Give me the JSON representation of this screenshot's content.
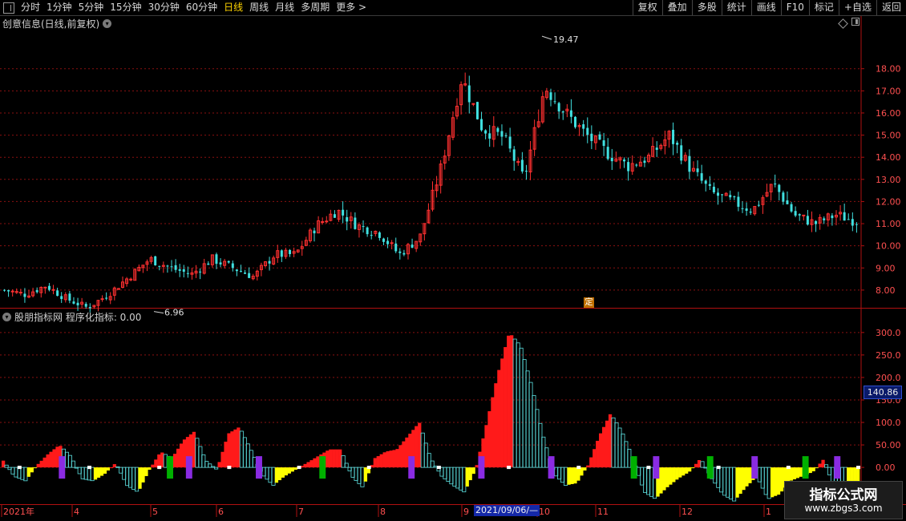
{
  "toolbar": {
    "periods": [
      "分时",
      "1分钟",
      "5分钟",
      "15分钟",
      "30分钟",
      "60分钟",
      "日线",
      "周线",
      "月线",
      "多周期",
      "更多 >"
    ],
    "active_period": "日线",
    "right_buttons": [
      "复权",
      "叠加",
      "多股",
      "统计",
      "画线",
      "F10",
      "标记",
      "+自选",
      "返回"
    ]
  },
  "main_panel": {
    "title": "创意信息(日线,前复权)",
    "price_axis": [
      "18.00",
      "17.00",
      "16.00",
      "15.00",
      "14.00",
      "13.00",
      "12.00",
      "11.00",
      "10.00",
      "9.00",
      "8.00"
    ],
    "high_label": "19.47",
    "low_label": "6.96",
    "marker_label": "定"
  },
  "indicator_panel": {
    "title": "股朋指标网 程序化指标: 0.00",
    "value_axis": [
      "300.0",
      "250.0",
      "200.0",
      "150.0",
      "100.0",
      "50.00",
      "0.00"
    ],
    "current_value": "140.86"
  },
  "date_axis": {
    "labels": [
      "2021年",
      "4",
      "5",
      "6",
      "7",
      "8",
      "9",
      "10",
      "11",
      "12",
      "1"
    ],
    "highlight": "2021/09/06/—"
  },
  "watermark": {
    "title": "指标公式网",
    "url": "www.zbgs3.com"
  },
  "colors": {
    "up": "#ff3030",
    "down": "#40e0e0",
    "grid": "#8a1010",
    "axis_text": "#ff5050",
    "active": "#ffd400"
  },
  "chart_data": [
    {
      "type": "candlestick",
      "ylim": [
        7.2,
        19.8
      ],
      "close_trend": [
        8.0,
        7.8,
        8.2,
        7.6,
        7.2,
        7.8,
        8.6,
        9.4,
        9.0,
        8.7,
        9.4,
        9.0,
        8.6,
        9.6,
        9.6,
        10.9,
        11.6,
        10.9,
        10.6,
        9.6,
        10.4,
        13.5,
        17.6,
        15.3,
        14.9,
        13.0,
        17.2,
        16.0,
        15.0,
        14.2,
        13.6,
        14.0,
        15.0,
        13.5,
        12.4,
        12.0,
        11.6,
        12.8,
        11.4,
        11.0,
        11.4,
        11.1
      ]
    },
    {
      "type": "histogram",
      "ylim": [
        -80,
        330
      ],
      "values": [
        15,
        -20,
        -30,
        5,
        30,
        50,
        25,
        -25,
        -30,
        -15,
        10,
        -40,
        -55,
        -5,
        35,
        20,
        60,
        80,
        15,
        -5,
        75,
        90,
        40,
        -15,
        -40,
        -20,
        -5,
        10,
        25,
        40,
        40,
        -20,
        -45,
        20,
        35,
        40,
        70,
        100,
        20,
        -20,
        -40,
        -55,
        -5,
        100,
        210,
        300,
        270,
        180,
        70,
        -15,
        -40,
        -35,
        5,
        70,
        120,
        80,
        20,
        -55,
        -70,
        -45,
        -25,
        -10,
        20,
        -25,
        -60,
        -75,
        -45,
        -20,
        -70,
        -60,
        -30,
        -20,
        -10,
        20,
        -60,
        -70,
        -60
      ]
    }
  ]
}
